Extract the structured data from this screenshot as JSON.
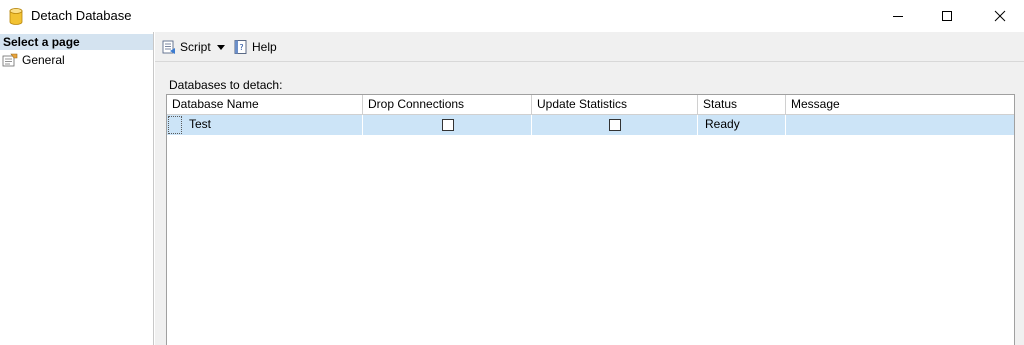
{
  "window": {
    "title": "Detach Database",
    "icon": "database-icon"
  },
  "left_pane": {
    "header": "Select a page",
    "pages": [
      {
        "label": "General",
        "icon": "general-page-icon"
      }
    ]
  },
  "toolbar": {
    "script_label": "Script",
    "help_label": "Help"
  },
  "main": {
    "section_label": "Databases to detach:",
    "columns": [
      "Database Name",
      "Drop Connections",
      "Update Statistics",
      "Status",
      "Message"
    ],
    "rows": [
      {
        "database_name": "Test",
        "drop_connections": false,
        "update_statistics": false,
        "status": "Ready",
        "message": ""
      }
    ]
  },
  "colors": {
    "selected_row": "#cce4f7",
    "left_header": "#d4e3f0",
    "pane_background": "#f0f0f0"
  }
}
